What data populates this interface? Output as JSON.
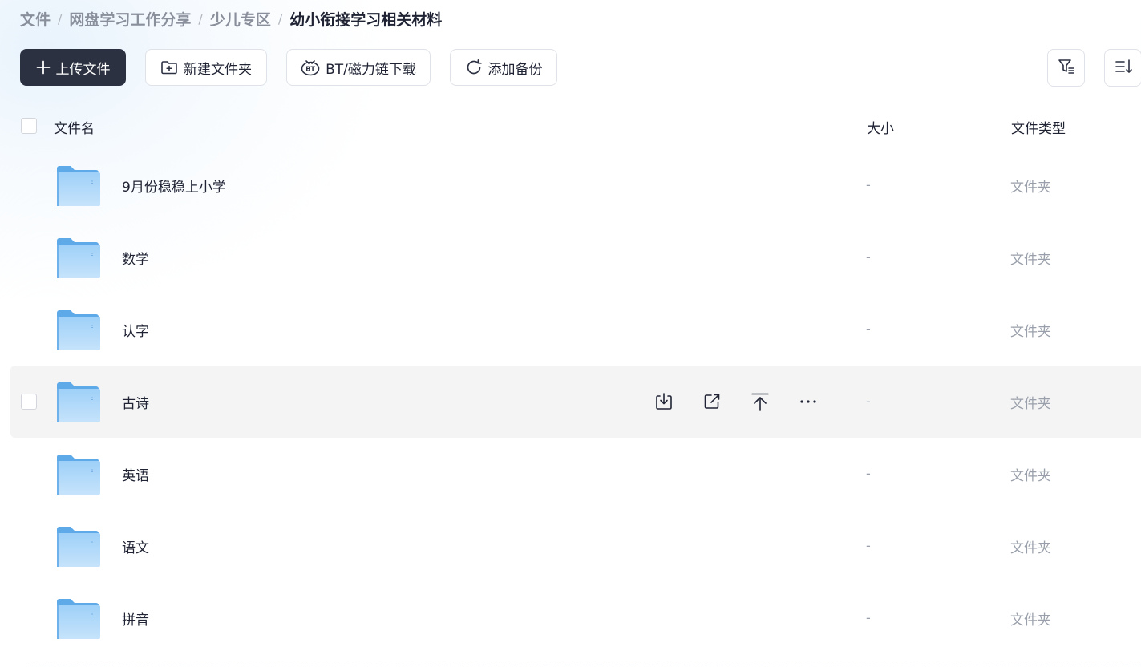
{
  "breadcrumb": {
    "items": [
      "文件",
      "网盘学习工作分享",
      "少儿专区"
    ],
    "current": "幼小衔接学习相关材料",
    "separator": "/"
  },
  "toolbar": {
    "upload_label": "上传文件",
    "new_folder_label": "新建文件夹",
    "bt_download_label": "BT/磁力链下载",
    "add_backup_label": "添加备份"
  },
  "table": {
    "columns": {
      "name": "文件名",
      "size": "大小",
      "type": "文件类型"
    },
    "rows": [
      {
        "name": "9月份稳稳上小学",
        "size": "-",
        "type": "文件夹"
      },
      {
        "name": "数学",
        "size": "-",
        "type": "文件夹"
      },
      {
        "name": "认字",
        "size": "-",
        "type": "文件夹"
      },
      {
        "name": "古诗",
        "size": "-",
        "type": "文件夹"
      },
      {
        "name": "英语",
        "size": "-",
        "type": "文件夹"
      },
      {
        "name": "语文",
        "size": "-",
        "type": "文件夹"
      },
      {
        "name": "拼音",
        "size": "-",
        "type": "文件夹"
      }
    ],
    "hovered_row": 3
  },
  "row_actions": [
    "download-icon",
    "share-icon",
    "move-to-top-icon",
    "more-icon"
  ],
  "colors": {
    "primary_button": "#2c3142",
    "folder_blue": "#7ab8ee",
    "muted_text": "#9aa0ab",
    "hover_row": "#f4f4f5"
  }
}
